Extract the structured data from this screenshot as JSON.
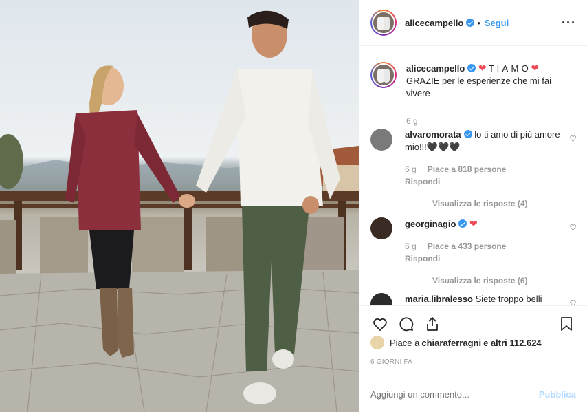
{
  "post": {
    "author": "alicecampello",
    "follow_label": "Segui",
    "caption_line1": "T-I-A-M-O",
    "caption_line2": "GRAZIE per le esperienze che mi fai vivere",
    "caption_time": "6 g"
  },
  "comments": [
    {
      "user": "alvaromorata",
      "text": "lo ti amo di più amore mio!!!🖤🖤🖤",
      "time": "6 g",
      "likes": "Piace a 818 persone",
      "reply": "Rispondi",
      "view_replies": "Visualizza le risposte (4)"
    },
    {
      "user": "georginagio",
      "text": "",
      "time": "6 g",
      "likes": "Piace a 433 persone",
      "reply": "Rispondi",
      "view_replies": "Visualizza le risposte (6)"
    },
    {
      "user": "maria.libralesso",
      "text": "Siete troppo belli"
    }
  ],
  "likes_line": {
    "prefix": "Piace a ",
    "user": "chiaraferragni",
    "suffix": " e altri 112.624"
  },
  "posted_ago": "6 GIORNI FA",
  "comment_box": {
    "placeholder": "Aggiungi un commento...",
    "publish_label": "Pubblica"
  },
  "icons": [
    "heart-icon",
    "comment-icon",
    "share-icon",
    "bookmark-icon",
    "more-icon",
    "verified-icon"
  ],
  "colors": {
    "link": "#3897f0",
    "heart": "#ed4956",
    "publish_disabled": "#b3dbff"
  }
}
